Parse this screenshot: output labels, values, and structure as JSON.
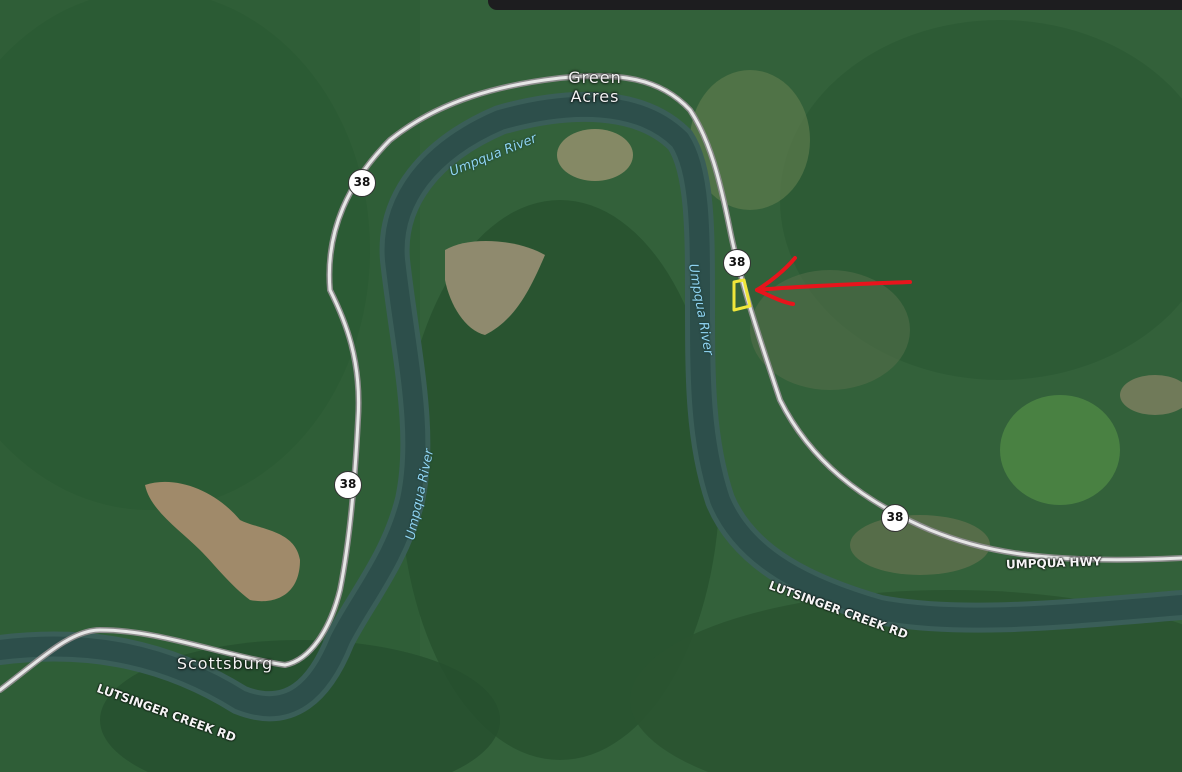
{
  "map": {
    "places": {
      "green_acres_line1": "Green",
      "green_acres_line2": "Acres",
      "scottsburg": "Scottsburg"
    },
    "rivers": {
      "upper": "Umpqua River",
      "center": "Umpqua River",
      "left": "Umpqua River"
    },
    "roads": {
      "umpqua_hwy": "UMPQUA HWY",
      "lutsinger_right": "LUTSINGER CREEK RD",
      "lutsinger_left": "LUTSINGER CREEK RD"
    },
    "route_shields": [
      "38",
      "38",
      "38",
      "38"
    ],
    "marker": {
      "parcel_color": "#f0e63a",
      "arrow_color": "#e8141c"
    }
  }
}
